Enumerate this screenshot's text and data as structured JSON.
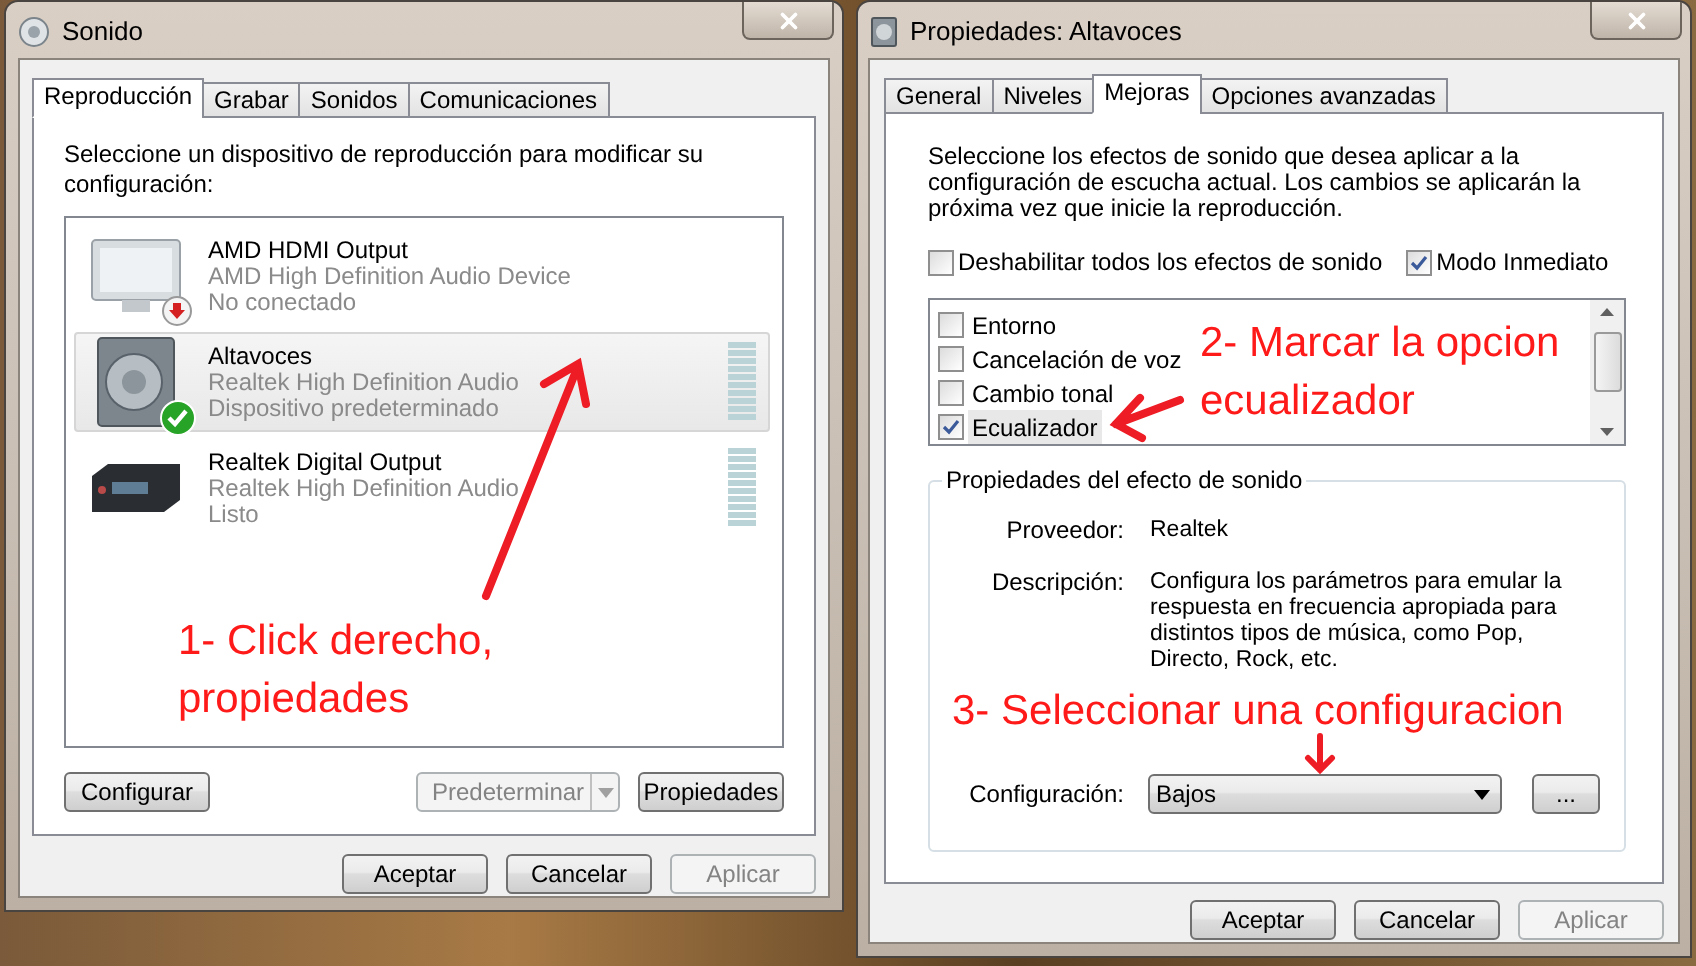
{
  "sound_window": {
    "title": "Sonido",
    "tabs": [
      {
        "label": "Reproducción",
        "selected": true
      },
      {
        "label": "Grabar",
        "selected": false
      },
      {
        "label": "Sonidos",
        "selected": false
      },
      {
        "label": "Comunicaciones",
        "selected": false
      }
    ],
    "instruction": "Seleccione un dispositivo de reproducción para modificar su configuración:",
    "devices": [
      {
        "name": "AMD HDMI Output",
        "driver": "AMD High Definition Audio Device",
        "status": "No conectado",
        "kind": "monitor",
        "disconnected": true,
        "is_default": false,
        "meter": false,
        "selected": false
      },
      {
        "name": "Altavoces",
        "driver": "Realtek High Definition Audio",
        "status": "Dispositivo predeterminado",
        "kind": "speaker",
        "disconnected": false,
        "is_default": true,
        "meter": true,
        "selected": true
      },
      {
        "name": "Realtek Digital Output",
        "driver": "Realtek High Definition Audio",
        "status": "Listo",
        "kind": "receiver",
        "disconnected": false,
        "is_default": false,
        "meter": true,
        "selected": false
      }
    ],
    "panel_buttons": [
      {
        "label": "Configurar",
        "disabled": false,
        "kind": "plain"
      },
      {
        "label": "Predeterminar",
        "disabled": true,
        "kind": "split"
      },
      {
        "label": "Propiedades",
        "disabled": false,
        "kind": "plain"
      }
    ],
    "dialog_buttons": [
      {
        "label": "Aceptar",
        "disabled": false
      },
      {
        "label": "Cancelar",
        "disabled": false
      },
      {
        "label": "Aplicar",
        "disabled": true
      }
    ]
  },
  "properties_window": {
    "title": "Propiedades: Altavoces",
    "tabs": [
      {
        "label": "General",
        "selected": false
      },
      {
        "label": "Niveles",
        "selected": false
      },
      {
        "label": "Mejoras",
        "selected": true
      },
      {
        "label": "Opciones avanzadas",
        "selected": false
      }
    ],
    "instruction": "Seleccione los efectos de sonido que desea aplicar a la configuración de escucha actual. Los cambios se aplicarán la próxima vez que inicie la reproducción.",
    "options": [
      {
        "label": "Deshabilitar todos los efectos de sonido",
        "checked": false
      },
      {
        "label": "Modo Inmediato",
        "checked": true
      }
    ],
    "effects": [
      {
        "label": "Entorno",
        "checked": false,
        "selected": false
      },
      {
        "label": "Cancelación de voz",
        "checked": false,
        "selected": false
      },
      {
        "label": "Cambio tonal",
        "checked": false,
        "selected": false
      },
      {
        "label": "Ecualizador",
        "checked": true,
        "selected": true
      }
    ],
    "effect_properties": {
      "title": "Propiedades del efecto de sonido",
      "rows": [
        {
          "label": "Proveedor:",
          "value": "Realtek"
        },
        {
          "label": "Descripción:",
          "value": "Configura los parámetros para emular la respuesta en frecuencia apropiada para distintos tipos de música, como Pop, Directo, Rock, etc."
        }
      ],
      "configuration": {
        "label": "Configuración:",
        "value": "Bajos",
        "more_button": "..."
      }
    },
    "dialog_buttons": [
      {
        "label": "Aceptar",
        "disabled": false
      },
      {
        "label": "Cancelar",
        "disabled": false
      },
      {
        "label": "Aplicar",
        "disabled": true
      }
    ]
  },
  "annotations": [
    {
      "text": "1- Click derecho,\npropiedades"
    },
    {
      "text": "2- Marcar la opcion\necualizador"
    },
    {
      "text": "3- Seleccionar una configuracion"
    }
  ]
}
